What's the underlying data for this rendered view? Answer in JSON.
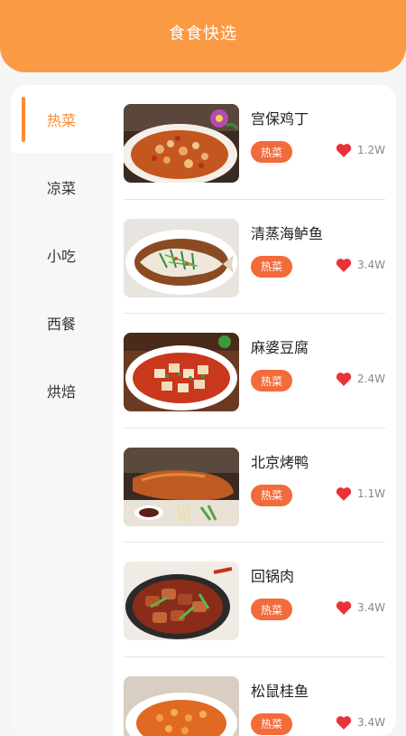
{
  "header": {
    "title": "食食快选"
  },
  "sidebar": {
    "items": [
      {
        "label": "热菜",
        "active": true
      },
      {
        "label": "凉菜",
        "active": false
      },
      {
        "label": "小吃",
        "active": false
      },
      {
        "label": "西餐",
        "active": false
      },
      {
        "label": "烘焙",
        "active": false
      }
    ]
  },
  "dishes": [
    {
      "name": "宫保鸡丁",
      "tag": "热菜",
      "likes": "1.2W"
    },
    {
      "name": "清蒸海鲈鱼",
      "tag": "热菜",
      "likes": "3.4W"
    },
    {
      "name": "麻婆豆腐",
      "tag": "热菜",
      "likes": "2.4W"
    },
    {
      "name": "北京烤鸭",
      "tag": "热菜",
      "likes": "1.1W"
    },
    {
      "name": "回锅肉",
      "tag": "热菜",
      "likes": "3.4W"
    },
    {
      "name": "松鼠桂鱼",
      "tag": "热菜",
      "likes": "3.4W"
    }
  ],
  "colors": {
    "accent": "#fb9a45",
    "active": "#fb8a2e",
    "tag": "#f26b3a",
    "heart": "#e8333a"
  },
  "icons": {
    "like": "heart-icon"
  }
}
